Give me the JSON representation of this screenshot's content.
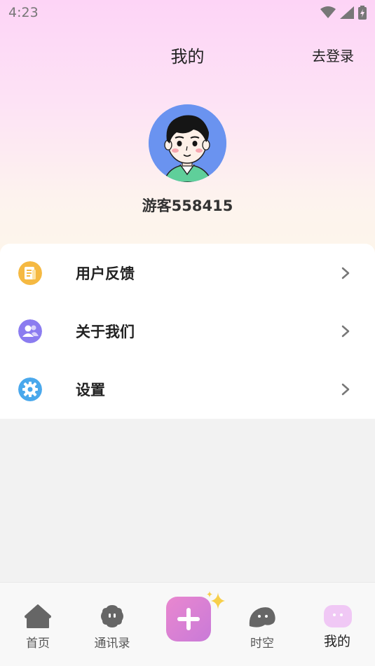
{
  "status_bar": {
    "time": "4:23"
  },
  "header": {
    "title": "我的",
    "login_label": "去登录"
  },
  "profile": {
    "username": "游客558415"
  },
  "menu": {
    "items": [
      {
        "label": "用户反馈",
        "icon": "feedback-icon",
        "color": "#f5b942"
      },
      {
        "label": "关于我们",
        "icon": "about-us-icon",
        "color": "#8b7cf0"
      },
      {
        "label": "设置",
        "icon": "settings-icon",
        "color": "#4aa8ec"
      }
    ]
  },
  "tabbar": {
    "tabs": [
      {
        "label": "首页",
        "icon": "home-icon"
      },
      {
        "label": "通讯录",
        "icon": "contacts-icon"
      },
      {
        "label": "",
        "icon": "add-icon"
      },
      {
        "label": "时空",
        "icon": "space-time-icon"
      },
      {
        "label": "我的",
        "icon": "mine-icon",
        "active": true
      }
    ]
  },
  "colors": {
    "accent_pink": "#e07fd0",
    "active_tab_bg": "#f0c8f5"
  }
}
